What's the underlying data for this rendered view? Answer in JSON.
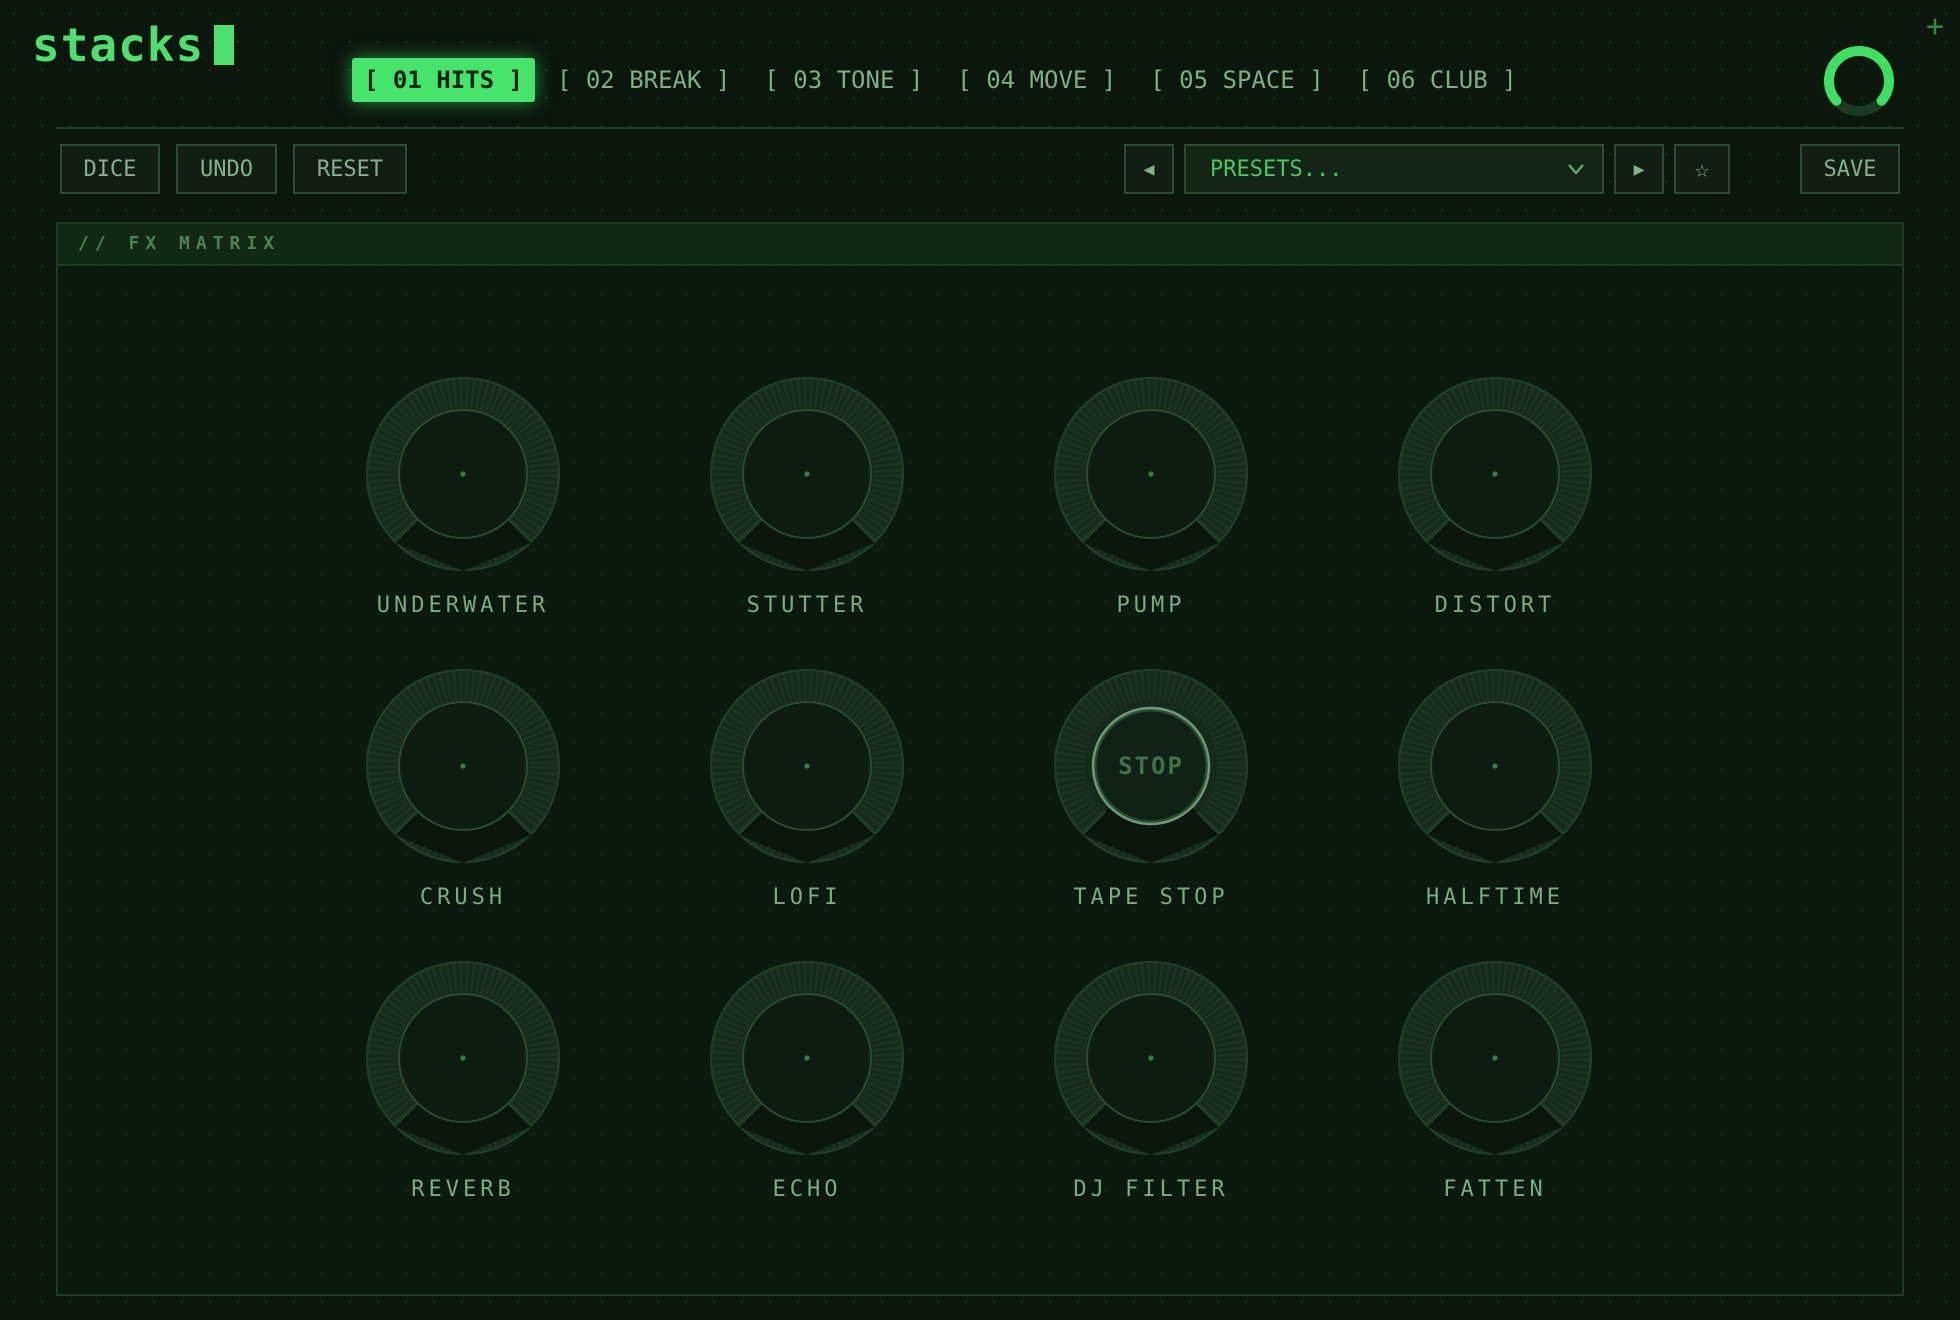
{
  "app": {
    "logo": "stacks",
    "plus_icon": "+"
  },
  "tabs": [
    {
      "label": "[ 01 HITS ]",
      "active": true
    },
    {
      "label": "[ 02 BREAK ]",
      "active": false
    },
    {
      "label": "[ 03 TONE ]",
      "active": false
    },
    {
      "label": "[ 04 MOVE ]",
      "active": false
    },
    {
      "label": "[ 05 SPACE ]",
      "active": false
    },
    {
      "label": "[ 06 CLUB ]",
      "active": false
    }
  ],
  "toolbar": {
    "dice": "DICE",
    "undo": "UNDO",
    "reset": "RESET",
    "prev_icon": "◀",
    "next_icon": "▶",
    "preset_placeholder": "PRESETS...",
    "favorite_icon": "☆",
    "save": "SAVE"
  },
  "panel": {
    "title": "// FX MATRIX"
  },
  "knobs": [
    {
      "label": "UNDERWATER"
    },
    {
      "label": "STUTTER"
    },
    {
      "label": "PUMP"
    },
    {
      "label": "DISTORT"
    },
    {
      "label": "CRUSH"
    },
    {
      "label": "LOFI"
    },
    {
      "label": "TAPE STOP",
      "center_text": "STOP"
    },
    {
      "label": "HALFTIME"
    },
    {
      "label": "REVERB"
    },
    {
      "label": "ECHO"
    },
    {
      "label": "DJ FILTER"
    },
    {
      "label": "FATTEN"
    }
  ],
  "colors": {
    "accent": "#46e46a",
    "background": "#0b160d",
    "muted": "#7fb487"
  }
}
